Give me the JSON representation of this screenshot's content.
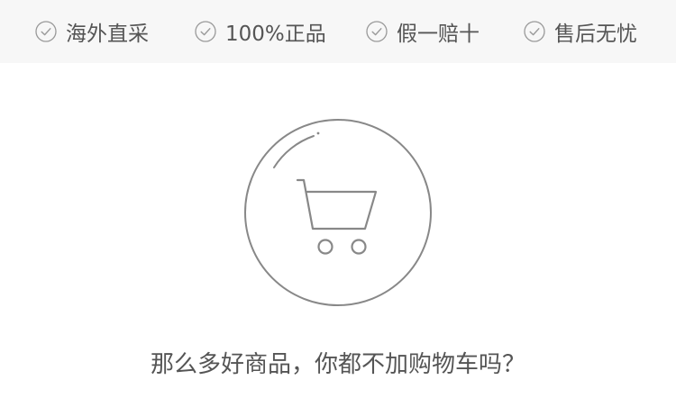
{
  "guarantees": [
    {
      "label": "海外直采",
      "icon": "check-circle-icon"
    },
    {
      "label": "100%正品",
      "icon": "check-circle-icon"
    },
    {
      "label": "假一赔十",
      "icon": "check-circle-icon"
    },
    {
      "label": "售后无忧",
      "icon": "check-circle-icon"
    }
  ],
  "empty_cart": {
    "icon": "shopping-cart-icon",
    "message": "那么多好商品，你都不加购物车吗？"
  },
  "colors": {
    "bar_background": "#f7f7f7",
    "text": "#555555",
    "icon_stroke": "#888888"
  }
}
